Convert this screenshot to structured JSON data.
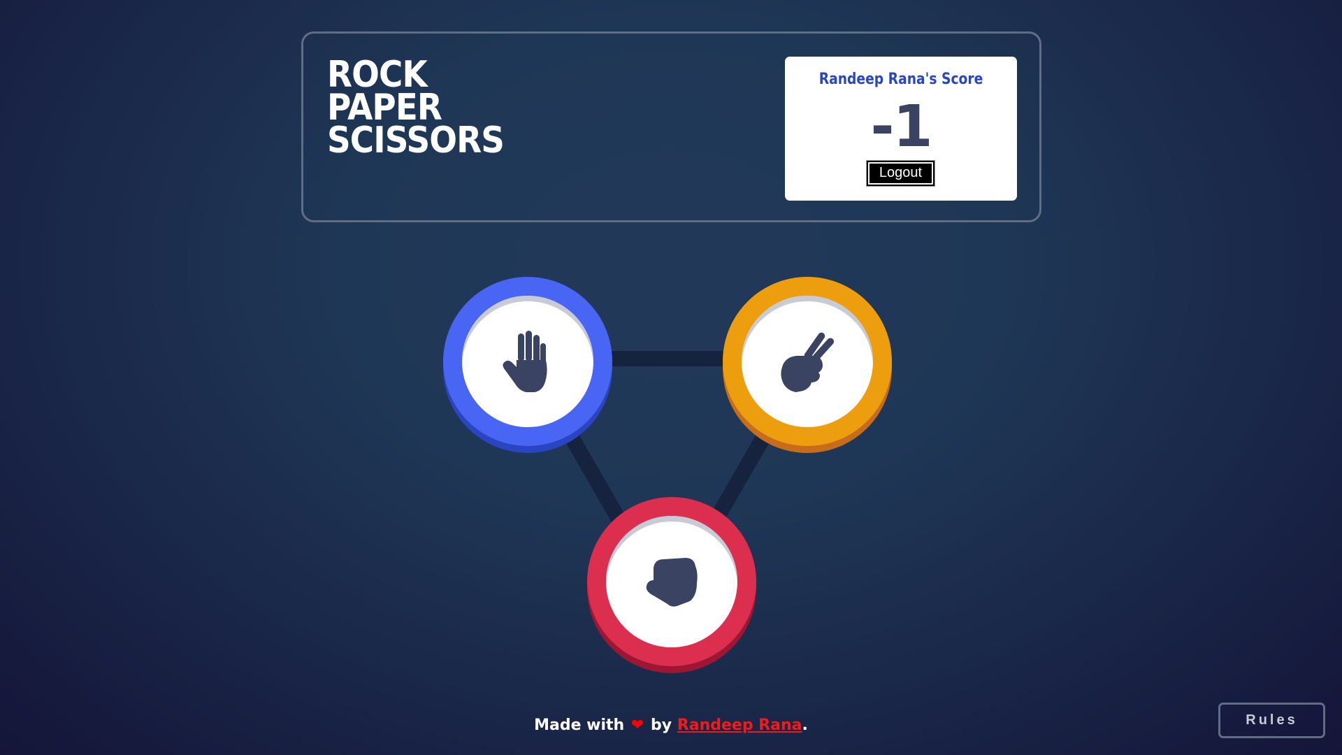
{
  "header": {
    "title_lines": [
      "ROCK",
      "PAPER",
      "SCISSORS"
    ],
    "score_label": "Randeep Rana's Score",
    "score_value": "-1",
    "logout_label": "Logout"
  },
  "game": {
    "choices": [
      {
        "id": "paper",
        "icon": "paper-hand-icon",
        "color": "#4865f4"
      },
      {
        "id": "scissors",
        "icon": "scissors-hand-icon",
        "color": "#ec9e0e"
      },
      {
        "id": "rock",
        "icon": "rock-fist-icon",
        "color": "#dc2e4e"
      }
    ]
  },
  "footer": {
    "made_with": "Made with",
    "by": "by",
    "author": "Randeep Rana",
    "period": "."
  },
  "rules_label": "Rules",
  "colors": {
    "accent_blue": "#2a46c0",
    "score_dark": "#3b4363",
    "link_red": "#f21b1b"
  }
}
